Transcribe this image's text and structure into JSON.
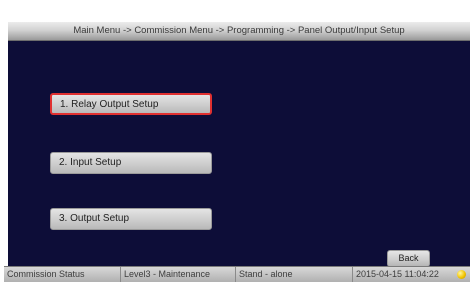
{
  "breadcrumb": {
    "text": "Main Menu -> Commission Menu -> Programming -> Panel Output/Input Setup"
  },
  "menu": {
    "items": [
      {
        "label": "1. Relay Output Setup",
        "selected": true
      },
      {
        "label": "2. Input Setup",
        "selected": false
      },
      {
        "label": "3. Output Setup",
        "selected": false
      }
    ]
  },
  "back_label": "Back",
  "status": {
    "commission": "Commission Status",
    "level": "Level3 - Maintenance",
    "mode": "Stand - alone",
    "datetime": "2015-04-15 11:04:22",
    "lamp_color": "#f3c500"
  },
  "colors": {
    "screen_background": "#0d0d38",
    "selected_border": "#e03030"
  }
}
